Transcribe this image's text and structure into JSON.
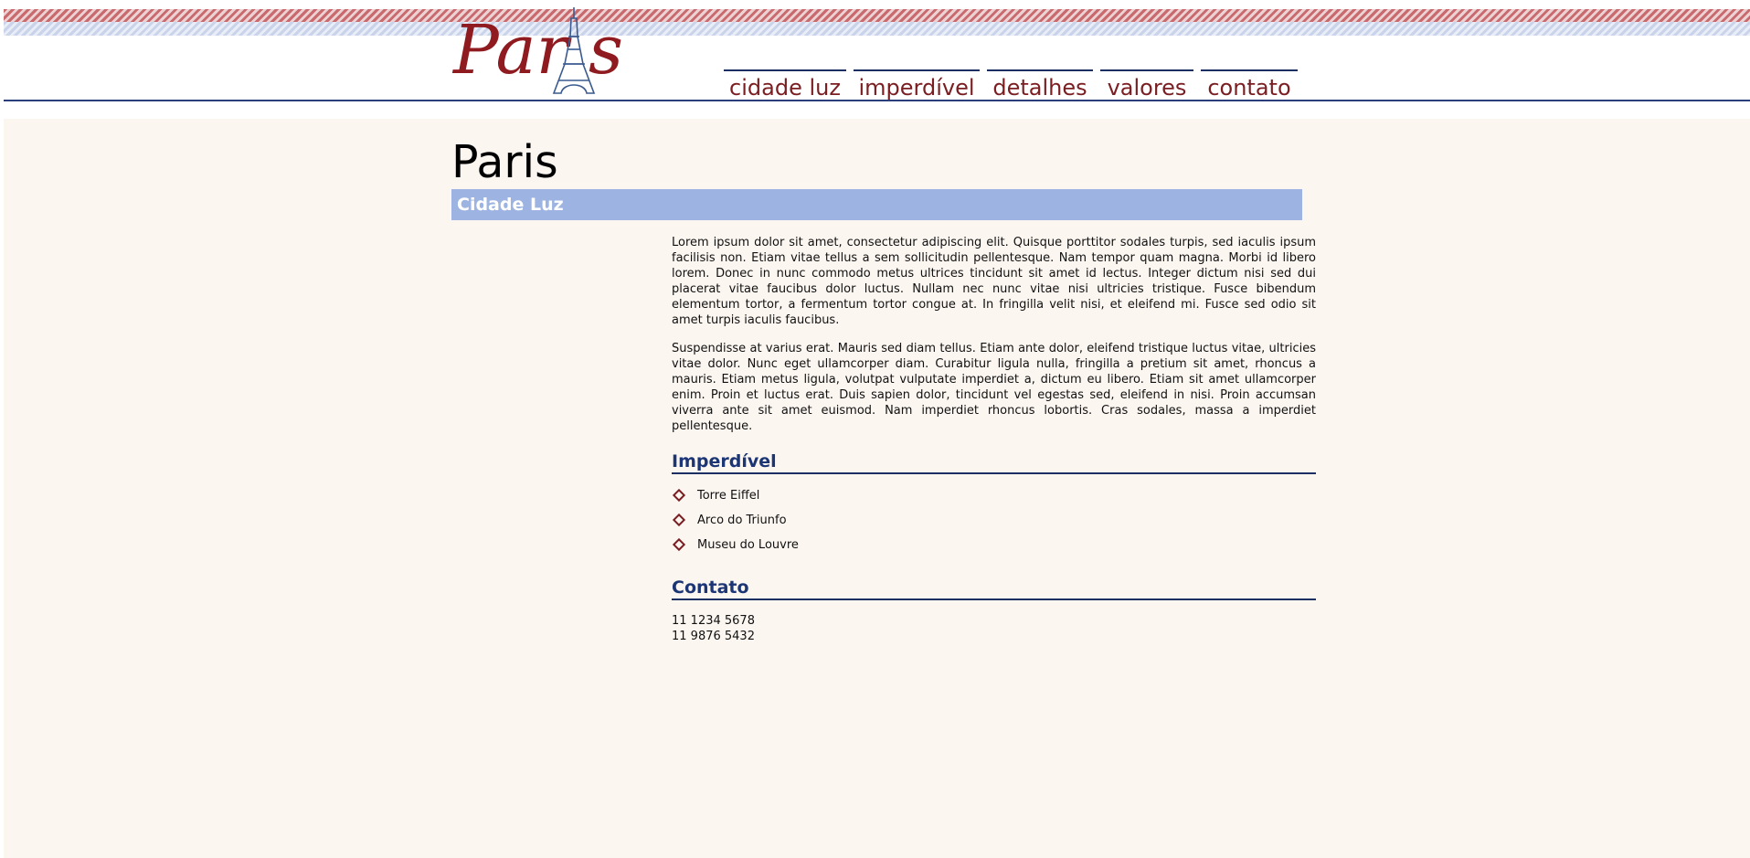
{
  "site": {
    "logo_text": "Paris"
  },
  "nav": {
    "items": [
      {
        "label": "cidade luz"
      },
      {
        "label": "imperdível"
      },
      {
        "label": "detalhes"
      },
      {
        "label": "valores"
      },
      {
        "label": "contato"
      }
    ]
  },
  "page": {
    "title": "Paris",
    "subtitle": "Cidade Luz",
    "paragraphs": [
      "Lorem ipsum dolor sit amet, consectetur adipiscing elit. Quisque porttitor sodales turpis, sed iaculis ipsum facilisis non. Etiam vitae tellus a sem sollicitudin pellentesque. Nam tempor quam magna. Morbi id libero lorem. Donec in nunc commodo metus ultrices tincidunt sit amet id lectus. Integer dictum nisi sed dui placerat vitae faucibus dolor luctus. Nullam nec nunc vitae nisi ultricies tristique. Fusce bibendum elementum tortor, a fermentum tortor congue at. In fringilla velit nisi, et eleifend mi. Fusce sed odio sit amet turpis iaculis faucibus.",
      "Suspendisse at varius erat. Mauris sed diam tellus. Etiam ante dolor, eleifend tristique luctus vitae, ultricies vitae dolor. Nunc eget ullamcorper diam. Curabitur ligula nulla, fringilla a pretium sit amet, rhoncus a mauris. Etiam metus ligula, volutpat vulputate imperdiet a, dictum eu libero. Etiam sit amet ullamcorper enim. Proin et luctus erat. Duis sapien dolor, tincidunt vel egestas sed, eleifend in nisi. Proin accumsan viverra ante sit amet euismod. Nam imperdiet rhoncus lobortis. Cras sodales, massa a imperdiet pellentesque."
    ],
    "imperdivel": {
      "heading": "Imperdível",
      "items": [
        "Torre Eiffel",
        "Arco do Triunfo",
        "Museu do Louvre"
      ]
    },
    "contato": {
      "heading": "Contato",
      "phones": [
        "11 1234 5678",
        "11 9876 5432"
      ]
    }
  },
  "colors": {
    "accent_red": "#7a1e22",
    "navy": "#1c2f63",
    "subtitle_bar": "#9db4e2",
    "page_bg": "#fcf6f1"
  },
  "icons": {
    "logo": "eiffel-tower-icon",
    "bullet": "diamond-bullet-icon"
  }
}
